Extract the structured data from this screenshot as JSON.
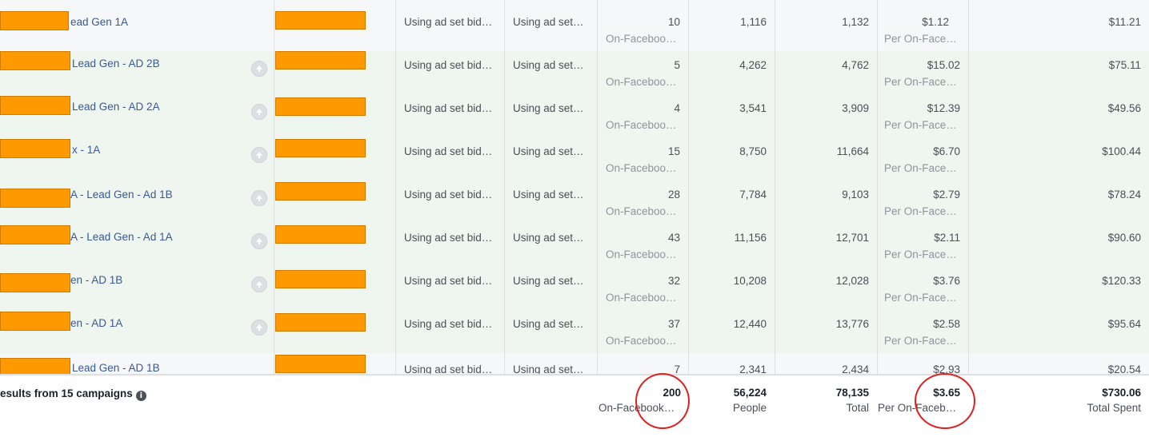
{
  "rows": [
    {
      "ad_name": "ead Gen 1A",
      "bid_strategy": "Using ad set bid…",
      "budget": "Using ad set…",
      "results": "10",
      "results_unit": "On-Faceboo…",
      "reach": "1,116",
      "impressions": "1,132",
      "cost_per_result": "$1.12",
      "cost_unit": "Per On-Face…",
      "amount_spent": "$11.21"
    },
    {
      "ad_name": "Lead Gen - AD 2B",
      "bid_strategy": "Using ad set bid…",
      "budget": "Using ad set…",
      "results": "5",
      "results_unit": "On-Faceboo…",
      "reach": "4,262",
      "impressions": "4,762",
      "cost_per_result": "$15.02",
      "cost_unit": "Per On-Face…",
      "amount_spent": "$75.11"
    },
    {
      "ad_name": "Lead Gen - AD 2A",
      "bid_strategy": "Using ad set bid…",
      "budget": "Using ad set…",
      "results": "4",
      "results_unit": "On-Faceboo…",
      "reach": "3,541",
      "impressions": "3,909",
      "cost_per_result": "$12.39",
      "cost_unit": "Per On-Face…",
      "amount_spent": "$49.56"
    },
    {
      "ad_name": "x - 1A",
      "bid_strategy": "Using ad set bid…",
      "budget": "Using ad set…",
      "results": "15",
      "results_unit": "On-Faceboo…",
      "reach": "8,750",
      "impressions": "11,664",
      "cost_per_result": "$6.70",
      "cost_unit": "Per On-Face…",
      "amount_spent": "$100.44"
    },
    {
      "ad_name": "A - Lead Gen - Ad 1B",
      "bid_strategy": "Using ad set bid…",
      "budget": "Using ad set…",
      "results": "28",
      "results_unit": "On-Faceboo…",
      "reach": "7,784",
      "impressions": "9,103",
      "cost_per_result": "$2.79",
      "cost_unit": "Per On-Face…",
      "amount_spent": "$78.24"
    },
    {
      "ad_name": "A - Lead Gen - Ad 1A",
      "bid_strategy": "Using ad set bid…",
      "budget": "Using ad set…",
      "results": "43",
      "results_unit": "On-Faceboo…",
      "reach": "11,156",
      "impressions": "12,701",
      "cost_per_result": "$2.11",
      "cost_unit": "Per On-Face…",
      "amount_spent": "$90.60"
    },
    {
      "ad_name": "en - AD 1B",
      "bid_strategy": "Using ad set bid…",
      "budget": "Using ad set…",
      "results": "32",
      "results_unit": "On-Faceboo…",
      "reach": "10,208",
      "impressions": "12,028",
      "cost_per_result": "$3.76",
      "cost_unit": "Per On-Face…",
      "amount_spent": "$120.33"
    },
    {
      "ad_name": "en - AD 1A",
      "bid_strategy": "Using ad set bid…",
      "budget": "Using ad set…",
      "results": "37",
      "results_unit": "On-Faceboo…",
      "reach": "12,440",
      "impressions": "13,776",
      "cost_per_result": "$2.58",
      "cost_unit": "Per On-Face…",
      "amount_spent": "$95.64"
    },
    {
      "ad_name": "Lead Gen - AD 1B",
      "bid_strategy": "Using ad set bid…",
      "budget": "Using ad set…",
      "results": "7",
      "results_unit": "",
      "reach": "2,341",
      "impressions": "2,434",
      "cost_per_result": "$2.93",
      "cost_unit": "",
      "amount_spent": "$20.54"
    }
  ],
  "footer": {
    "label": "esults from 15 campaigns",
    "results": "200",
    "results_unit": "On-Facebook…",
    "reach": "56,224",
    "reach_unit": "People",
    "impressions": "78,135",
    "impressions_unit": "Total",
    "cost_per_result": "$3.65",
    "cost_unit": "Per On-Faceb…",
    "amount_spent": "$730.06",
    "amount_spent_unit": "Total Spent"
  },
  "icons": {
    "info": "info-icon",
    "upgrade": "up-arrow-icon"
  },
  "colors": {
    "redaction": "#ff9900",
    "link": "#385898",
    "highlight_circle": "#e02020",
    "row_highlight": "#eef6ef"
  }
}
